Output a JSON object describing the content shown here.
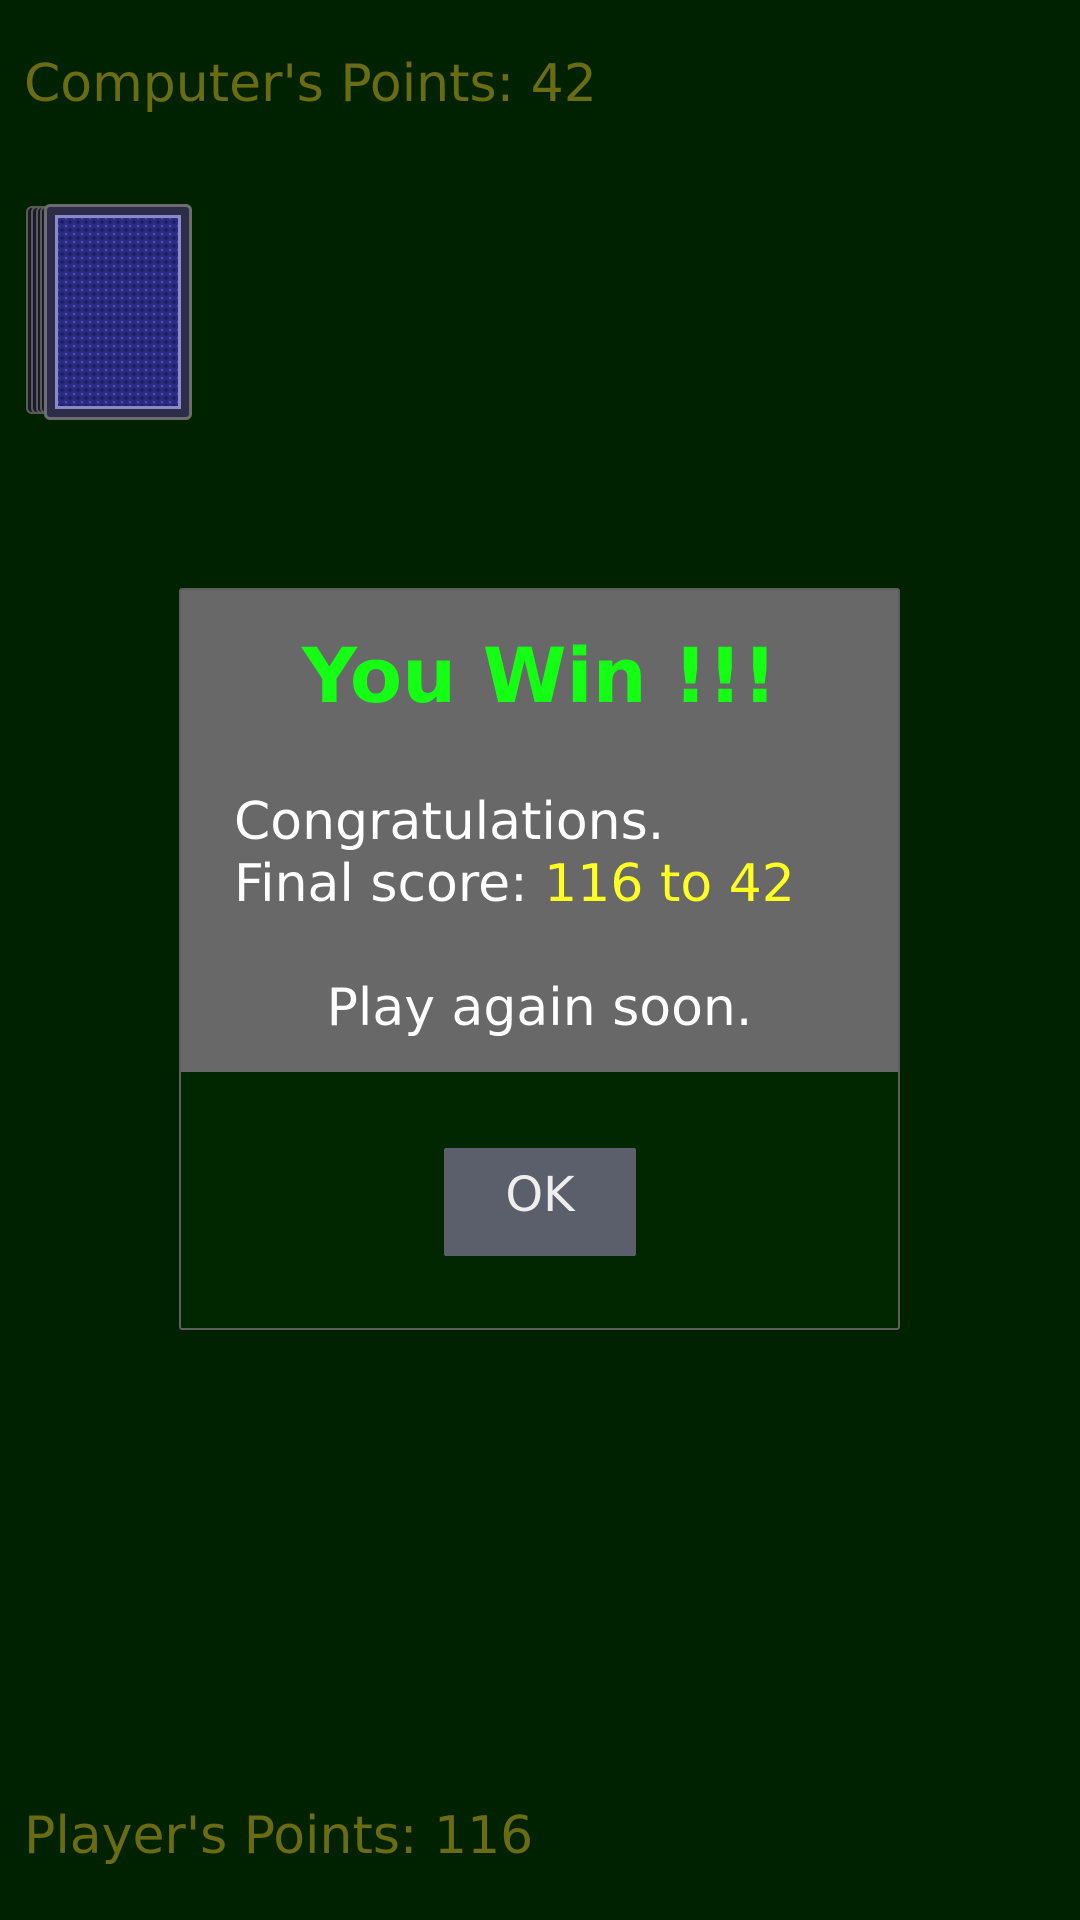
{
  "scores": {
    "computer_label": "Computer's Points: 42",
    "player_label": "Player's Points: 116"
  },
  "deck": {
    "icon": "card-back"
  },
  "dialog": {
    "title": "You Win !!!",
    "congrats": "Congratulations.",
    "final_prefix": "Final score: ",
    "final_value": "116 to 42",
    "play_again": "Play again soon.",
    "ok_label": "OK"
  },
  "colors": {
    "background": "#002200",
    "score_text": "#6b6b12",
    "title": "#14ff14",
    "highlight": "#ffff22",
    "dialog_body": "#686868",
    "button": "#5b5f6b"
  }
}
